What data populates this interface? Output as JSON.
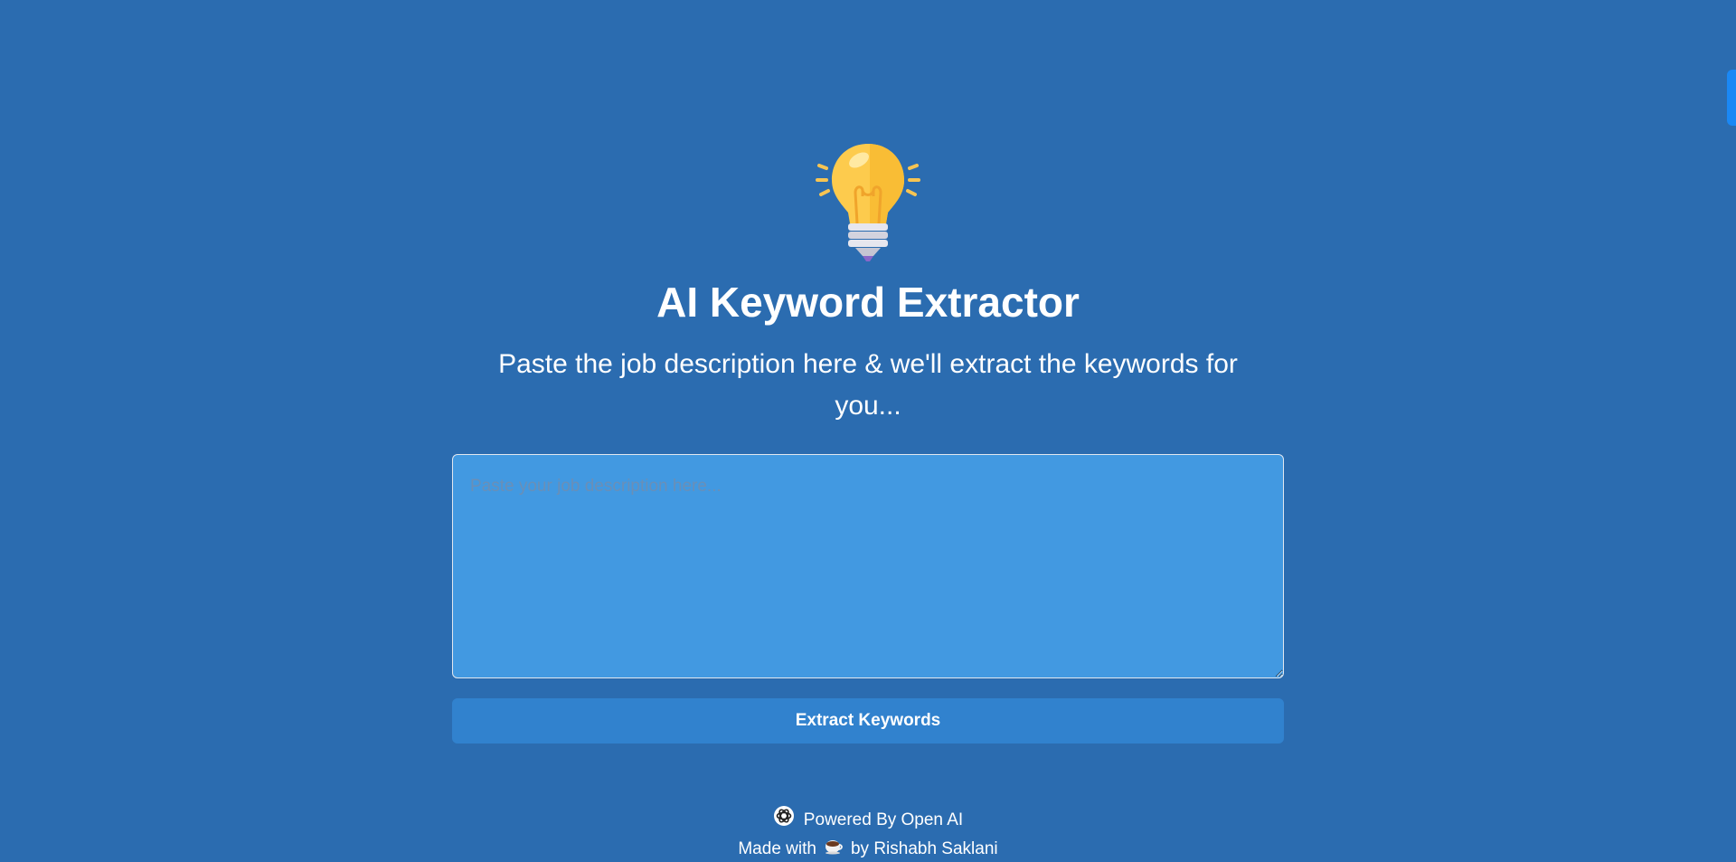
{
  "header": {
    "logo_icon": "lightbulb-icon",
    "title": "AI Keyword Extractor",
    "subtitle": "Paste the job description here & we'll extract the keywords for you..."
  },
  "form": {
    "placeholder": "Paste your job description here...",
    "value": "",
    "submit_label": "Extract Keywords"
  },
  "footer": {
    "powered_icon": "openai-logo-icon",
    "powered_label": "Powered By Open AI",
    "made_with_label": "Made with",
    "made_with_icon": "coffee-icon",
    "author_label": "by Rishabh Saklani"
  },
  "colors": {
    "background": "#2b6cb0",
    "textarea_bg": "#4299e1",
    "button_bg": "#3182ce",
    "side_tab": "#1a88f5"
  }
}
